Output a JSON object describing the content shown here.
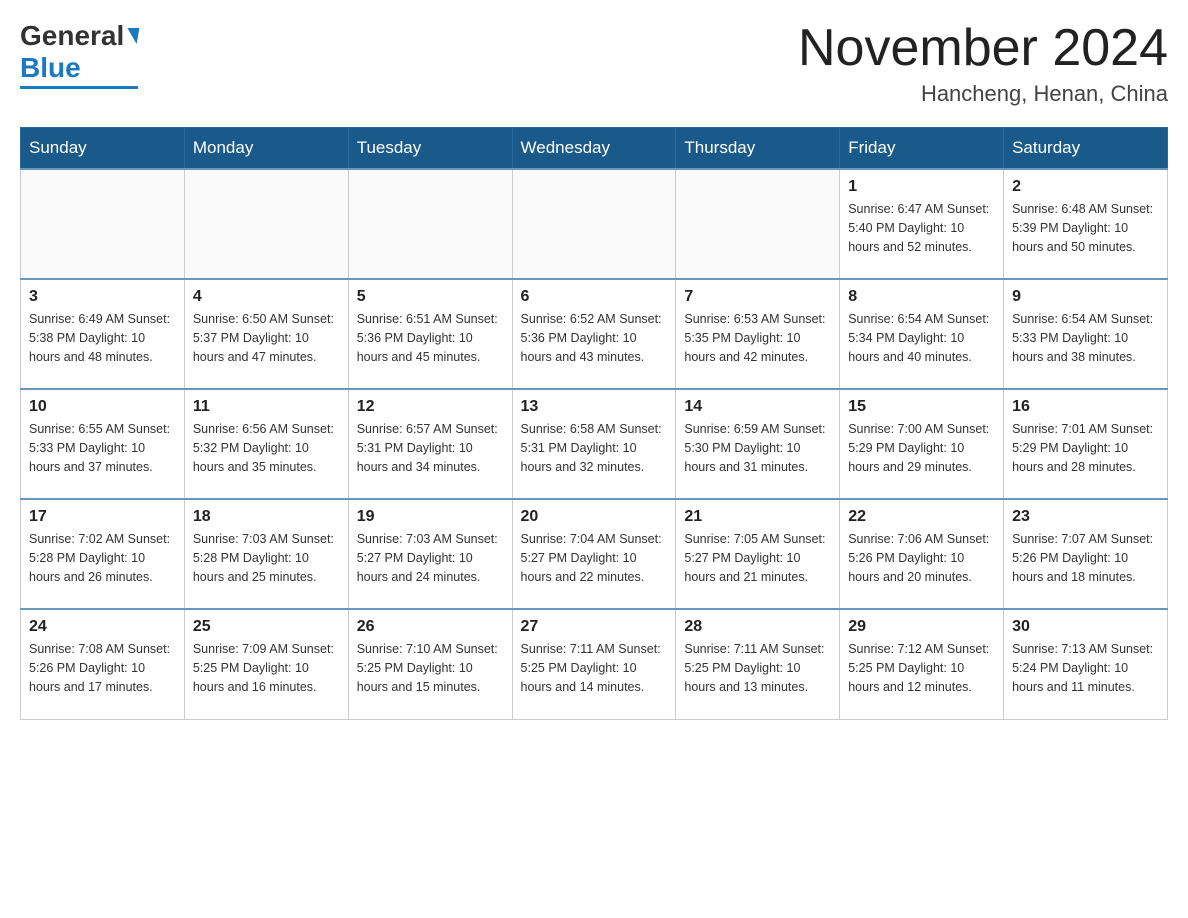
{
  "logo": {
    "general": "General",
    "blue": "Blue"
  },
  "title": "November 2024",
  "subtitle": "Hancheng, Henan, China",
  "weekdays": [
    "Sunday",
    "Monday",
    "Tuesday",
    "Wednesday",
    "Thursday",
    "Friday",
    "Saturday"
  ],
  "weeks": [
    [
      {
        "day": null,
        "info": ""
      },
      {
        "day": null,
        "info": ""
      },
      {
        "day": null,
        "info": ""
      },
      {
        "day": null,
        "info": ""
      },
      {
        "day": null,
        "info": ""
      },
      {
        "day": "1",
        "info": "Sunrise: 6:47 AM\nSunset: 5:40 PM\nDaylight: 10 hours and 52 minutes."
      },
      {
        "day": "2",
        "info": "Sunrise: 6:48 AM\nSunset: 5:39 PM\nDaylight: 10 hours and 50 minutes."
      }
    ],
    [
      {
        "day": "3",
        "info": "Sunrise: 6:49 AM\nSunset: 5:38 PM\nDaylight: 10 hours and 48 minutes."
      },
      {
        "day": "4",
        "info": "Sunrise: 6:50 AM\nSunset: 5:37 PM\nDaylight: 10 hours and 47 minutes."
      },
      {
        "day": "5",
        "info": "Sunrise: 6:51 AM\nSunset: 5:36 PM\nDaylight: 10 hours and 45 minutes."
      },
      {
        "day": "6",
        "info": "Sunrise: 6:52 AM\nSunset: 5:36 PM\nDaylight: 10 hours and 43 minutes."
      },
      {
        "day": "7",
        "info": "Sunrise: 6:53 AM\nSunset: 5:35 PM\nDaylight: 10 hours and 42 minutes."
      },
      {
        "day": "8",
        "info": "Sunrise: 6:54 AM\nSunset: 5:34 PM\nDaylight: 10 hours and 40 minutes."
      },
      {
        "day": "9",
        "info": "Sunrise: 6:54 AM\nSunset: 5:33 PM\nDaylight: 10 hours and 38 minutes."
      }
    ],
    [
      {
        "day": "10",
        "info": "Sunrise: 6:55 AM\nSunset: 5:33 PM\nDaylight: 10 hours and 37 minutes."
      },
      {
        "day": "11",
        "info": "Sunrise: 6:56 AM\nSunset: 5:32 PM\nDaylight: 10 hours and 35 minutes."
      },
      {
        "day": "12",
        "info": "Sunrise: 6:57 AM\nSunset: 5:31 PM\nDaylight: 10 hours and 34 minutes."
      },
      {
        "day": "13",
        "info": "Sunrise: 6:58 AM\nSunset: 5:31 PM\nDaylight: 10 hours and 32 minutes."
      },
      {
        "day": "14",
        "info": "Sunrise: 6:59 AM\nSunset: 5:30 PM\nDaylight: 10 hours and 31 minutes."
      },
      {
        "day": "15",
        "info": "Sunrise: 7:00 AM\nSunset: 5:29 PM\nDaylight: 10 hours and 29 minutes."
      },
      {
        "day": "16",
        "info": "Sunrise: 7:01 AM\nSunset: 5:29 PM\nDaylight: 10 hours and 28 minutes."
      }
    ],
    [
      {
        "day": "17",
        "info": "Sunrise: 7:02 AM\nSunset: 5:28 PM\nDaylight: 10 hours and 26 minutes."
      },
      {
        "day": "18",
        "info": "Sunrise: 7:03 AM\nSunset: 5:28 PM\nDaylight: 10 hours and 25 minutes."
      },
      {
        "day": "19",
        "info": "Sunrise: 7:03 AM\nSunset: 5:27 PM\nDaylight: 10 hours and 24 minutes."
      },
      {
        "day": "20",
        "info": "Sunrise: 7:04 AM\nSunset: 5:27 PM\nDaylight: 10 hours and 22 minutes."
      },
      {
        "day": "21",
        "info": "Sunrise: 7:05 AM\nSunset: 5:27 PM\nDaylight: 10 hours and 21 minutes."
      },
      {
        "day": "22",
        "info": "Sunrise: 7:06 AM\nSunset: 5:26 PM\nDaylight: 10 hours and 20 minutes."
      },
      {
        "day": "23",
        "info": "Sunrise: 7:07 AM\nSunset: 5:26 PM\nDaylight: 10 hours and 18 minutes."
      }
    ],
    [
      {
        "day": "24",
        "info": "Sunrise: 7:08 AM\nSunset: 5:26 PM\nDaylight: 10 hours and 17 minutes."
      },
      {
        "day": "25",
        "info": "Sunrise: 7:09 AM\nSunset: 5:25 PM\nDaylight: 10 hours and 16 minutes."
      },
      {
        "day": "26",
        "info": "Sunrise: 7:10 AM\nSunset: 5:25 PM\nDaylight: 10 hours and 15 minutes."
      },
      {
        "day": "27",
        "info": "Sunrise: 7:11 AM\nSunset: 5:25 PM\nDaylight: 10 hours and 14 minutes."
      },
      {
        "day": "28",
        "info": "Sunrise: 7:11 AM\nSunset: 5:25 PM\nDaylight: 10 hours and 13 minutes."
      },
      {
        "day": "29",
        "info": "Sunrise: 7:12 AM\nSunset: 5:25 PM\nDaylight: 10 hours and 12 minutes."
      },
      {
        "day": "30",
        "info": "Sunrise: 7:13 AM\nSunset: 5:24 PM\nDaylight: 10 hours and 11 minutes."
      }
    ]
  ]
}
